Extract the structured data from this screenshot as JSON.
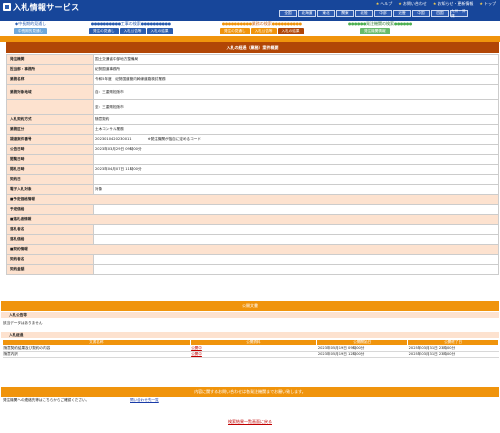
{
  "header": {
    "app_title": "入札情報サービス",
    "util_links": [
      "ヘルプ",
      "お問い合わせ",
      "お知らせ・更新情報",
      "トップ"
    ],
    "regions": [
      "全国",
      "北海道",
      "東北",
      "関東",
      "北陸",
      "中部",
      "近畿",
      "中国",
      "四国",
      "九州・沖縄"
    ]
  },
  "nav": {
    "groups": [
      {
        "heading": "◆中長期的見通し",
        "tabs": [
          "中長期的見通し"
        ]
      },
      {
        "heading": "工事の検索",
        "tabs": [
          "発注の見通し",
          "入札公告等",
          "入札の結果"
        ]
      },
      {
        "heading": "業務の検索",
        "tabs": [
          "発注の見通し",
          "入札公告等",
          "入札の結果"
        ]
      },
      {
        "heading": "発注機関の検索",
        "tabs": [
          "発注機関情報"
        ]
      }
    ]
  },
  "panel": {
    "title": "入札の経過（業務）案件概要"
  },
  "rows": [
    {
      "type": "kv",
      "key": "発注機関",
      "value": "国土交通省中部地方整備局"
    },
    {
      "type": "kv",
      "key": "担当部・事務所",
      "value": "紀勢国道事務所"
    },
    {
      "type": "kv",
      "key": "業務名称",
      "value": "令和5年度　紀勢国道管内幹線道路検討業務"
    },
    {
      "type": "kv",
      "key": "業務対象地域",
      "value": "自：三重県松阪市",
      "tall": true
    },
    {
      "type": "kv",
      "key": "",
      "value": "至：三重県松阪市",
      "tall": true
    },
    {
      "type": "kv",
      "key": "入札契約方式",
      "value": "随意契約"
    },
    {
      "type": "kv",
      "key": "業務区分",
      "value": "土木コンサル業務"
    },
    {
      "type": "kv",
      "key": "調達案件番号",
      "value": "2023010420230011",
      "note": "※発注機関が独自に定めるコード"
    },
    {
      "type": "kv",
      "key": "公告日時",
      "value": "2023年03月29日 09時00分"
    },
    {
      "type": "kv",
      "key": "閲覧日時",
      "value": ""
    },
    {
      "type": "kv",
      "key": "開札日時",
      "value": "2023年04月07日 11時00分"
    },
    {
      "type": "kv",
      "key": "契約日",
      "value": ""
    },
    {
      "type": "kv",
      "key": "電子入札対象",
      "value": "対象"
    },
    {
      "type": "section",
      "label": "■予定価格情報"
    },
    {
      "type": "kv",
      "key": "予定価格",
      "value": ""
    },
    {
      "type": "section",
      "label": "■落札者情報"
    },
    {
      "type": "kv",
      "key": "落札者名",
      "value": ""
    },
    {
      "type": "kv",
      "key": "落札価格",
      "value": ""
    },
    {
      "type": "section",
      "label": "■契約情報"
    },
    {
      "type": "kv",
      "key": "契約者名",
      "value": ""
    },
    {
      "type": "kv",
      "key": "契約金額",
      "value": ""
    }
  ],
  "public_docs": {
    "title": "公開文書",
    "bid_announcement_label": "入札公告等",
    "no_data_text": "該当データはありません",
    "bid_results_label": "入札経過",
    "columns": [
      "文書名称",
      "公開資料",
      "公開開始日",
      "公開終了日"
    ],
    "docs": [
      {
        "name": "随意契約結果及び契約の内容",
        "link": "公開中",
        "start": "2023年05月19日 09時00分",
        "end": "2025年03月31日 23時00分"
      },
      {
        "name": "随意内訳",
        "link": "公開中",
        "start": "2023年05月19日 12時00分",
        "end": "2025年03月31日 23時00分"
      }
    ]
  },
  "contact": {
    "bar_text": "内容に関するお問い合わせは各発注機関までお願い致します。",
    "label": "発注機関への連絡先等はこちらからご確認ください。",
    "link": "問い合わせ先一覧"
  },
  "back_link": "検索結果一覧画面に戻る",
  "colors": {
    "header_blue": "#17469a",
    "orange": "#f0940c",
    "dark_orange": "#b14606",
    "peach": "#fde2cf",
    "link_red": "#c00000"
  }
}
